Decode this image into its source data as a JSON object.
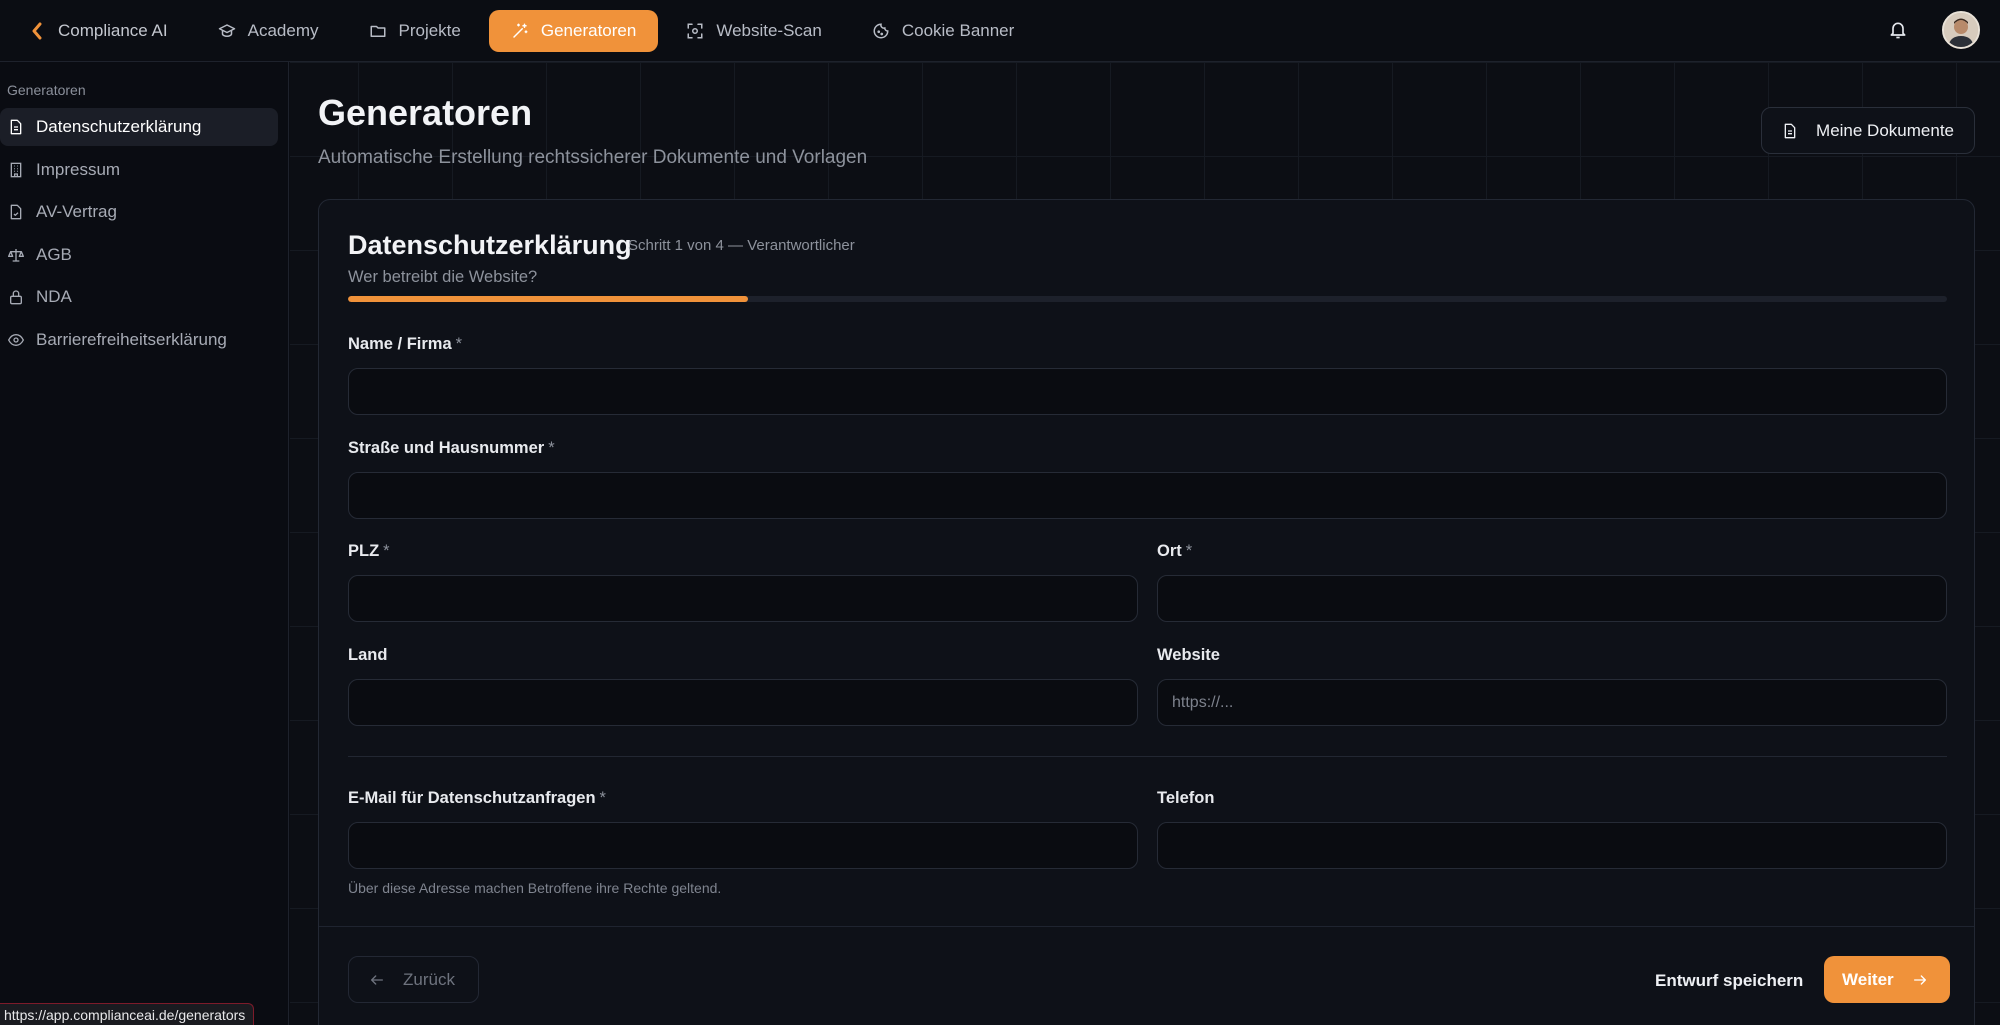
{
  "nav": {
    "back_label": "Compliance AI",
    "items": [
      {
        "label": "Academy",
        "icon": "graduation-cap-icon"
      },
      {
        "label": "Projekte",
        "icon": "folder-icon"
      },
      {
        "label": "Generatoren",
        "icon": "magic-wand-icon",
        "active": true
      },
      {
        "label": "Website-Scan",
        "icon": "scan-icon"
      },
      {
        "label": "Cookie Banner",
        "icon": "cookie-icon"
      }
    ],
    "accent": "#f0923a"
  },
  "sidebar": {
    "heading": "Generatoren",
    "items": [
      {
        "label": "Datenschutzerklärung",
        "icon": "file-text-icon",
        "active": true
      },
      {
        "label": "Impressum",
        "icon": "building-icon"
      },
      {
        "label": "AV-Vertrag",
        "icon": "file-check-icon"
      },
      {
        "label": "AGB",
        "icon": "scale-icon"
      },
      {
        "label": "NDA",
        "icon": "lock-icon"
      },
      {
        "label": "Barrierefreiheitserklärung",
        "icon": "eye-icon"
      }
    ]
  },
  "page": {
    "title": "Generatoren",
    "subtitle": "Automatische Erstellung rechtssicherer Dokumente und Vorlagen",
    "docs_button": "Meine Dokumente"
  },
  "form": {
    "title": "Datenschutzerklärung",
    "step": "Schritt 1 von 4 — Verantwortlicher",
    "description": "Wer betreibt die Website?",
    "progress": 0.25,
    "required_mark": "*",
    "fields": {
      "name": {
        "label": "Name / Firma",
        "value": ""
      },
      "street": {
        "label": "Straße und Hausnummer",
        "value": ""
      },
      "zip": {
        "label": "PLZ",
        "value": ""
      },
      "city": {
        "label": "Ort",
        "value": ""
      },
      "country": {
        "label": "Land",
        "value": ""
      },
      "website": {
        "label": "Website",
        "value": "",
        "placeholder": "https://..."
      },
      "email": {
        "label": "E-Mail für Datenschutzanfragen",
        "value": ""
      },
      "phone": {
        "label": "Telefon",
        "value": ""
      }
    },
    "email_hint": "Über diese Adresse machen Betroffene ihre Rechte geltend.",
    "back_label": "Zurück",
    "draft_label": "Entwurf speichern",
    "next_label": "Weiter"
  },
  "status_url": "https://app.complianceai.de/generators"
}
